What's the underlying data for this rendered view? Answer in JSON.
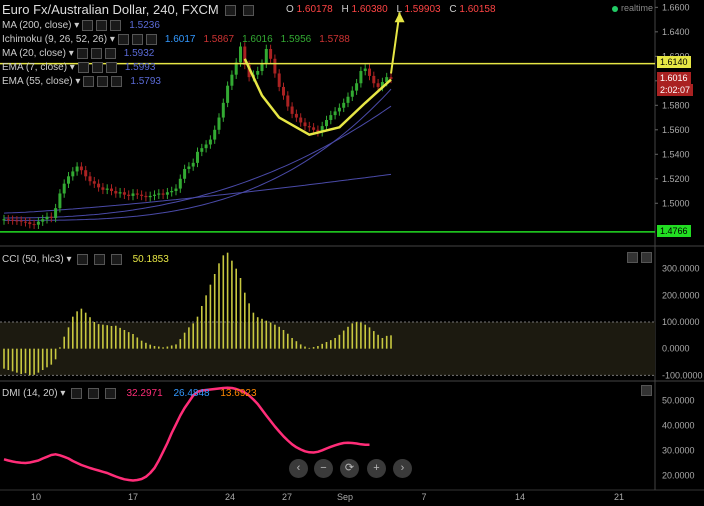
{
  "header": {
    "title": "Euro Fx/Australian Dollar, 240, FXCM",
    "ohlc": [
      {
        "k": "O",
        "v": "1.60178"
      },
      {
        "k": "H",
        "v": "1.60380"
      },
      {
        "k": "L",
        "v": "1.59903"
      },
      {
        "k": "C",
        "v": "1.60158"
      }
    ],
    "realtime": "realtime"
  },
  "indicators": [
    {
      "label": "MA (200, close)",
      "values": [
        "1.5236"
      ],
      "colors": [
        "#5a6ad6"
      ]
    },
    {
      "label": "Ichimoku (9, 26, 52, 26)",
      "values": [
        "1.6017",
        "1.5867",
        "1.6016",
        "1.5956",
        "1.5788"
      ],
      "colors": [
        "#3399ff",
        "#cc3333",
        "#33aa33",
        "#33aa33",
        "#cc3333"
      ]
    },
    {
      "label": "MA (20, close)",
      "values": [
        "1.5932"
      ],
      "colors": [
        "#5a6ad6"
      ]
    },
    {
      "label": "EMA (7, close)",
      "values": [
        "1.5993"
      ],
      "colors": [
        "#5a6ad6"
      ]
    },
    {
      "label": "EMA (55, close)",
      "values": [
        "1.5793"
      ],
      "colors": [
        "#5a6ad6"
      ]
    }
  ],
  "cci": {
    "label": "CCI (50, hlc3)",
    "value": "50.1853",
    "color": "#e6e645"
  },
  "dmi": {
    "label": "DMI (14, 20)",
    "values": [
      "32.2971",
      "26.4848",
      "13.6923"
    ],
    "colors": [
      "#ff2d78",
      "#3399ff",
      "#ff8800"
    ]
  },
  "price_tags": {
    "resistance": "1.6140",
    "last": "1.6016",
    "countdown": "2:02:07",
    "support": "1.4766"
  },
  "colors": {
    "bull": "#33aa33",
    "bear": "#aa2222",
    "resistance": "#e6e645",
    "support": "#22dd22",
    "cup": "#e6e645",
    "cci": "#c8c840",
    "dmi": "#ff2d78",
    "ma": "#4a4aa8"
  },
  "nav_buttons": [
    "‹",
    "−",
    "⟳",
    "+",
    "›"
  ],
  "chart_data": [
    {
      "type": "candlestick",
      "title": "Euro Fx/Australian Dollar, 240, FXCM",
      "x_tick_labels": [
        "10",
        "17",
        "24",
        "27",
        "Sep",
        "7",
        "14",
        "21"
      ],
      "y_tick_labels": [
        "1.6600",
        "1.6400",
        "1.6200",
        "1.6000",
        "1.5800",
        "1.5600",
        "1.5400",
        "1.5200",
        "1.5000"
      ],
      "ylim": [
        1.47,
        1.666
      ],
      "resistance": 1.614,
      "support": 1.4766,
      "close_series": [
        1.487,
        1.4865,
        1.486,
        1.4858,
        1.485,
        1.4845,
        1.483,
        1.4825,
        1.485,
        1.487,
        1.489,
        1.488,
        1.496,
        1.508,
        1.516,
        1.522,
        1.526,
        1.53,
        1.527,
        1.522,
        1.518,
        1.516,
        1.513,
        1.511,
        1.512,
        1.51,
        1.508,
        1.509,
        1.507,
        1.506,
        1.508,
        1.507,
        1.506,
        1.505,
        1.506,
        1.507,
        1.508,
        1.507,
        1.509,
        1.51,
        1.512,
        1.52,
        1.528,
        1.53,
        1.533,
        1.542,
        1.545,
        1.548,
        1.552,
        1.56,
        1.57,
        1.582,
        1.596,
        1.605,
        1.615,
        1.628,
        1.613,
        1.603,
        1.605,
        1.608,
        1.614,
        1.626,
        1.618,
        1.606,
        1.595,
        1.588,
        1.579,
        1.573,
        1.57,
        1.566,
        1.563,
        1.562,
        1.56,
        1.558,
        1.563,
        1.568,
        1.572,
        1.575,
        1.578,
        1.582,
        1.587,
        1.592,
        1.598,
        1.608,
        1.61,
        1.604,
        1.598,
        1.595,
        1.599,
        1.603,
        1.6016
      ],
      "ma_200": [
        1.492,
        1.5236
      ],
      "ema_55": [
        1.488,
        1.5793
      ],
      "ma_20": [
        1.486,
        1.5932
      ],
      "cup_pattern": [
        [
          56,
          1.618
        ],
        [
          60,
          1.588
        ],
        [
          64,
          1.57
        ],
        [
          71,
          1.556
        ],
        [
          78,
          1.562
        ],
        [
          84,
          1.582
        ],
        [
          90,
          1.601
        ]
      ],
      "breakout_arrow": [
        [
          90,
          1.606
        ],
        [
          92,
          1.656
        ]
      ]
    },
    {
      "type": "bar",
      "title": "CCI (50, hlc3)",
      "y_tick_labels": [
        "300.0000",
        "200.0000",
        "100.0000",
        "0.0000",
        "-100.0000"
      ],
      "ylim": [
        -110,
        370
      ],
      "bands": [
        100,
        -100
      ],
      "values": [
        -75,
        -80,
        -85,
        -90,
        -95,
        -92,
        -100,
        -98,
        -90,
        -80,
        -70,
        -60,
        -40,
        5,
        45,
        80,
        120,
        140,
        150,
        135,
        118,
        100,
        92,
        90,
        88,
        85,
        86,
        78,
        70,
        62,
        55,
        42,
        30,
        22,
        15,
        10,
        8,
        5,
        8,
        12,
        16,
        36,
        60,
        80,
        95,
        120,
        160,
        200,
        240,
        280,
        320,
        350,
        360,
        330,
        300,
        265,
        210,
        170,
        135,
        118,
        112,
        105,
        98,
        90,
        82,
        70,
        56,
        40,
        28,
        16,
        8,
        3,
        6,
        10,
        18,
        25,
        32,
        40,
        52,
        68,
        82,
        95,
        100,
        98,
        90,
        80,
        66,
        52,
        40,
        48,
        50
      ]
    },
    {
      "type": "line",
      "title": "DMI (14, 20)",
      "y_tick_labels": [
        "50.0000",
        "40.0000",
        "30.0000",
        "20.0000"
      ],
      "ylim": [
        15,
        57
      ],
      "values": [
        26.5,
        26,
        25.6,
        25.3,
        25.1,
        25,
        25.2,
        25.6,
        26,
        26.8,
        27.5,
        28.2,
        28.5,
        28.1,
        27.5,
        26.8,
        25.8,
        25,
        24.2,
        23.6,
        23,
        22.5,
        22,
        21.5,
        21,
        20.3,
        19.6,
        19,
        18.5,
        18.2,
        18,
        18.2,
        18.6,
        19.5,
        21,
        23,
        26,
        29.5,
        33,
        37,
        40.5,
        44,
        47,
        49.5,
        52,
        53.5,
        54,
        54.2,
        54.4,
        54.6,
        54.8,
        55,
        55.1,
        55,
        54.6,
        54,
        53.2,
        52,
        50.4,
        48.6,
        46.3,
        44,
        41.8,
        39.6,
        37.6,
        35.7,
        34,
        32.5,
        31.3,
        30.4,
        29.7,
        29.3,
        29.2,
        29.5,
        30.1,
        30.8,
        31.5,
        32.1,
        32.6,
        33,
        33.1,
        33,
        32.8,
        32.5,
        32.3,
        32.3
      ]
    }
  ]
}
